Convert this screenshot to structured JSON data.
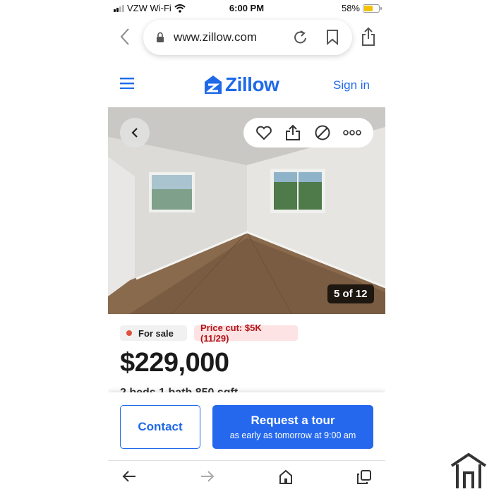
{
  "status_bar": {
    "carrier": "VZW Wi-Fi",
    "time": "6:00 PM",
    "battery": "58%",
    "battery_level": 0.58
  },
  "browser": {
    "url": "www.zillow.com"
  },
  "header": {
    "brand": "Zillow",
    "sign_in": "Sign in"
  },
  "gallery": {
    "counter": "5 of 12"
  },
  "listing": {
    "status": "For sale",
    "price_cut": "Price cut: $5K (11/29)",
    "price": "$229,000",
    "facts_partial": "2 beds  1 bath  850 sqft"
  },
  "cta": {
    "contact": "Contact",
    "request_tour": "Request a tour",
    "tour_subtext": "as early as tomorrow at 9:00 am"
  },
  "colors": {
    "brand_blue": "#1f69e8",
    "tour_blue": "#2568ee",
    "price_cut_red": "#b3151b",
    "sale_dot": "#e0503e"
  }
}
